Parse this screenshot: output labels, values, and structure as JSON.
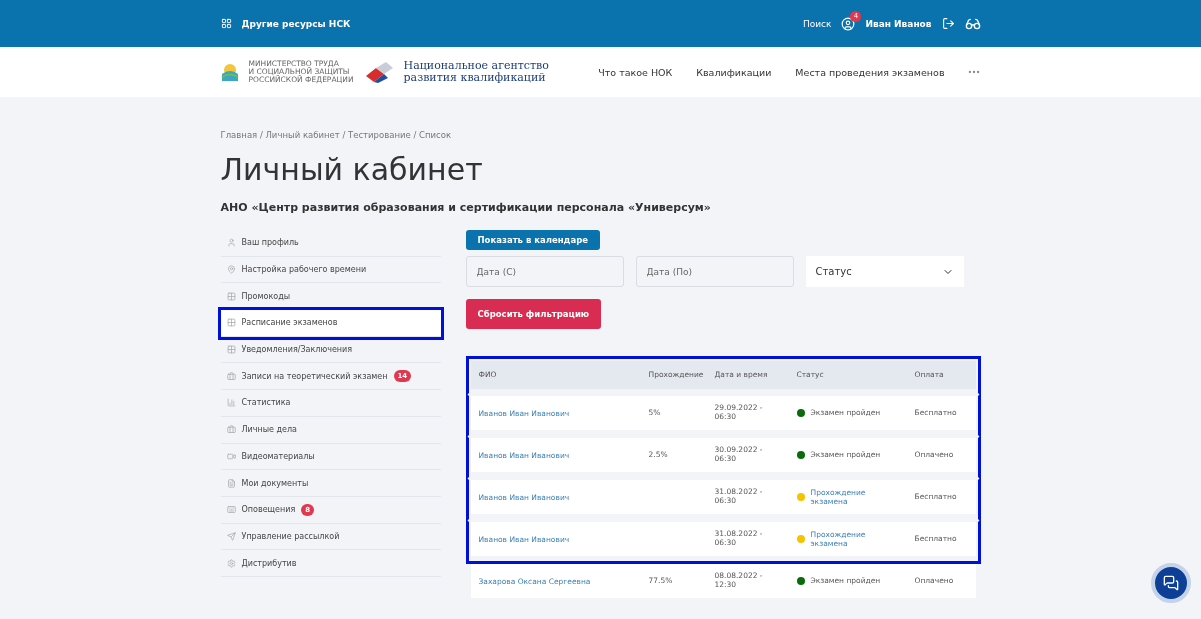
{
  "top_bar": {
    "resources": "Другие ресурсы НСК",
    "search": "Поиск",
    "user": {
      "name": "Иван Иванов",
      "notifications": "4"
    }
  },
  "nav": {
    "ministry": [
      "МИНИСТЕРСТВО ТРУДА",
      "И СОЦИАЛЬНОЙ ЗАЩИТЫ",
      "РОССИЙСКОЙ ФЕДЕРАЦИИ"
    ],
    "agency": [
      "Национальное агентство",
      "развития квалификаций"
    ],
    "links": [
      "Что такое НОК",
      "Квалификации",
      "Места проведения экзаменов"
    ]
  },
  "breadcrumbs": "Главная / Личный кабинет / Тестирование / Список",
  "title": "Личный кабинет",
  "organization": "АНО «Центр развития образования и сертификации персонала «Универсум»",
  "sidebar": {
    "items": [
      {
        "label": "Ваш профиль",
        "highlighted": false
      },
      {
        "label": "Настройка рабочего времени",
        "highlighted": false
      },
      {
        "label": "Промокоды",
        "highlighted": false
      },
      {
        "label": "Расписание экзаменов",
        "highlighted": true
      },
      {
        "label": "Уведомления/Заключения",
        "highlighted": false
      },
      {
        "label": "Записи на теоретический экзамен",
        "badge": "14",
        "highlighted": false
      },
      {
        "label": "Статистика",
        "highlighted": false
      },
      {
        "label": "Личные дела",
        "highlighted": false
      },
      {
        "label": "Видеоматериалы",
        "highlighted": false
      },
      {
        "label": "Мои документы",
        "highlighted": false
      },
      {
        "label": "Оповещения",
        "badge": "8",
        "highlighted": false
      },
      {
        "label": "Управление рассылкой",
        "highlighted": false
      },
      {
        "label": "Дистрибутив",
        "highlighted": false
      }
    ]
  },
  "filters": {
    "calendar_button": "Показать в календаре",
    "date_from": {
      "placeholder": "Дата (С)"
    },
    "date_to": {
      "placeholder": "Дата (По)"
    },
    "status": "Статус",
    "reset_button": "Сбросить фильтрацию"
  },
  "table": {
    "columns": [
      "ФИО",
      "Прохождение",
      "Дата и время",
      "Статус",
      "Оплата"
    ],
    "rows": [
      {
        "name": "Иванов Иван Иванович",
        "progress": "5%",
        "date": "29.09.2022 -",
        "time": "06:30",
        "status": "Экзамен пройден",
        "kind": "done",
        "color": "#0a6b0a",
        "payment": "Бесплатно",
        "highlighted": true
      },
      {
        "name": "Иванов Иван Иванович",
        "progress": "2.5%",
        "date": "30.09.2022 -",
        "time": "06:30",
        "status": "Экзамен пройден",
        "kind": "done",
        "color": "#0a6b0a",
        "payment": "Оплачено",
        "highlighted": true
      },
      {
        "name": "Иванов Иван Иванович",
        "date": "31.08.2022 -",
        "time": "06:30",
        "status": "Прохождение экзамена",
        "kind": "link",
        "color": "#f5c400",
        "payment": "Бесплатно",
        "highlighted": true
      },
      {
        "name": "Иванов Иван Иванович",
        "date": "31.08.2022 -",
        "time": "06:30",
        "status": "Прохождение экзамена",
        "kind": "link",
        "color": "#f5c400",
        "payment": "Бесплатно",
        "highlighted": true
      },
      {
        "name": "Захарова Оксана Сергеевна",
        "progress": "77.5%",
        "date": "08.08.2022 -",
        "time": "12:30",
        "status": "Экзамен пройден",
        "kind": "done",
        "color": "#0a6b0a",
        "payment": "Оплачено",
        "highlighted": false
      }
    ]
  }
}
